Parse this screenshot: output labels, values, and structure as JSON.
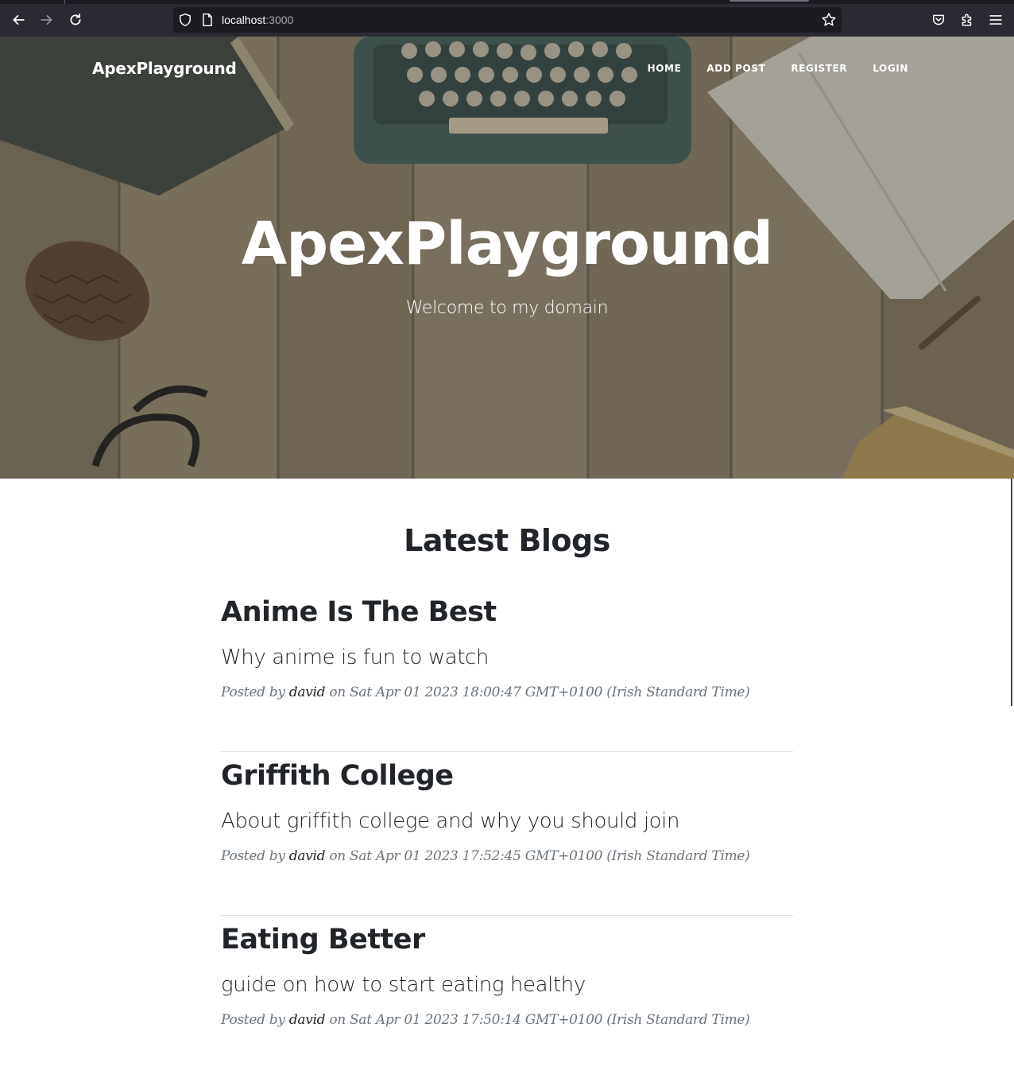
{
  "browser": {
    "url_host": "localhost",
    "url_port": ":3000",
    "icons": [
      "back-arrow-icon",
      "forward-arrow-icon",
      "reload-icon",
      "shield-icon",
      "page-icon",
      "star-icon",
      "pocket-icon",
      "extensions-icon",
      "menu-icon"
    ]
  },
  "site": {
    "brand": "ApexPlayground",
    "nav": [
      "HOME",
      "ADD POST",
      "REGISTER",
      "LOGIN"
    ]
  },
  "hero": {
    "title": "ApexPlayground",
    "subtitle": "Welcome to my domain"
  },
  "main": {
    "section_title": "Latest Blogs",
    "posts": [
      {
        "title": "Anime Is The Best",
        "subtitle": "Why anime is fun to watch",
        "posted_by": "Posted by",
        "author": "david",
        "date": "on Sat Apr 01 2023 18:00:47 GMT+0100 (Irish Standard Time)"
      },
      {
        "title": "Griffith College",
        "subtitle": "About griffith college and why you should join",
        "posted_by": "Posted by",
        "author": "david",
        "date": "on Sat Apr 01 2023 17:52:45 GMT+0100 (Irish Standard Time)"
      },
      {
        "title": "Eating Better",
        "subtitle": "guide on how to start eating healthy",
        "posted_by": "Posted by",
        "author": "david",
        "date": "on Sat Apr 01 2023 17:50:14 GMT+0100 (Irish Standard Time)"
      }
    ]
  },
  "colors": {
    "chrome_bg": "#2b2a33",
    "urlbar_bg": "#1c1b22",
    "heading": "#212529",
    "meta": "#6c757d",
    "divider": "#dee2e6"
  }
}
